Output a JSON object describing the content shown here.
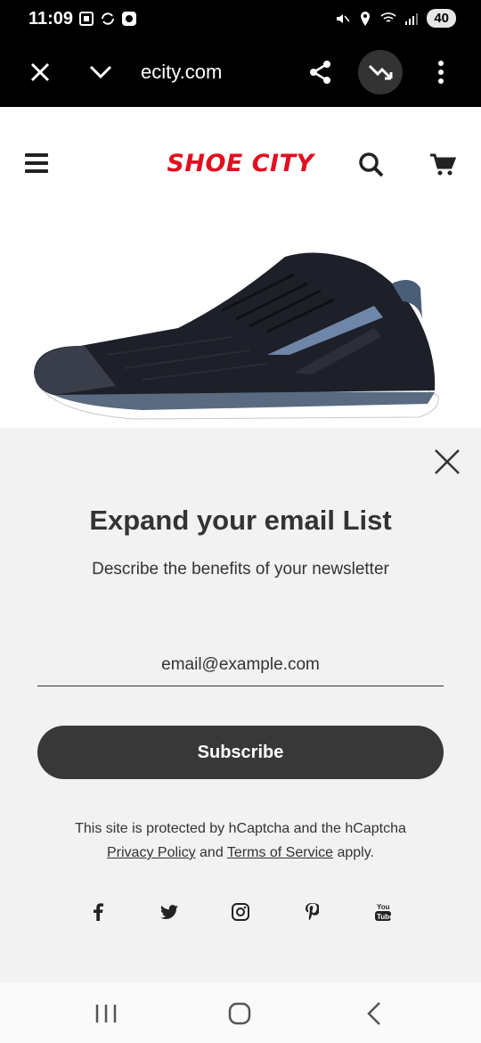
{
  "status_bar": {
    "time": "11:09",
    "battery": "40",
    "network": "5"
  },
  "browser": {
    "url": "ecity.com",
    "close_icon": "close-icon",
    "menu_icon": "chevron-down-icon"
  },
  "header": {
    "logo": "SHOE CITY"
  },
  "popup": {
    "title": "Expand your email List",
    "subtitle": "Describe the benefits of your newsletter",
    "email_placeholder": "email@example.com",
    "subscribe_label": "Subscribe",
    "captcha_line1": "This site is protected by hCaptcha and the hCaptcha",
    "privacy_link": "Privacy Policy",
    "and_text": "and",
    "terms_link": "Terms of Service",
    "apply_text": "apply.",
    "socials": [
      "facebook-icon",
      "twitter-icon",
      "instagram-icon",
      "pinterest-icon",
      "youtube-icon"
    ]
  },
  "colors": {
    "brand_red": "#e10f1f",
    "popup_bg": "#f2f2f2",
    "button_dark": "#383838"
  }
}
